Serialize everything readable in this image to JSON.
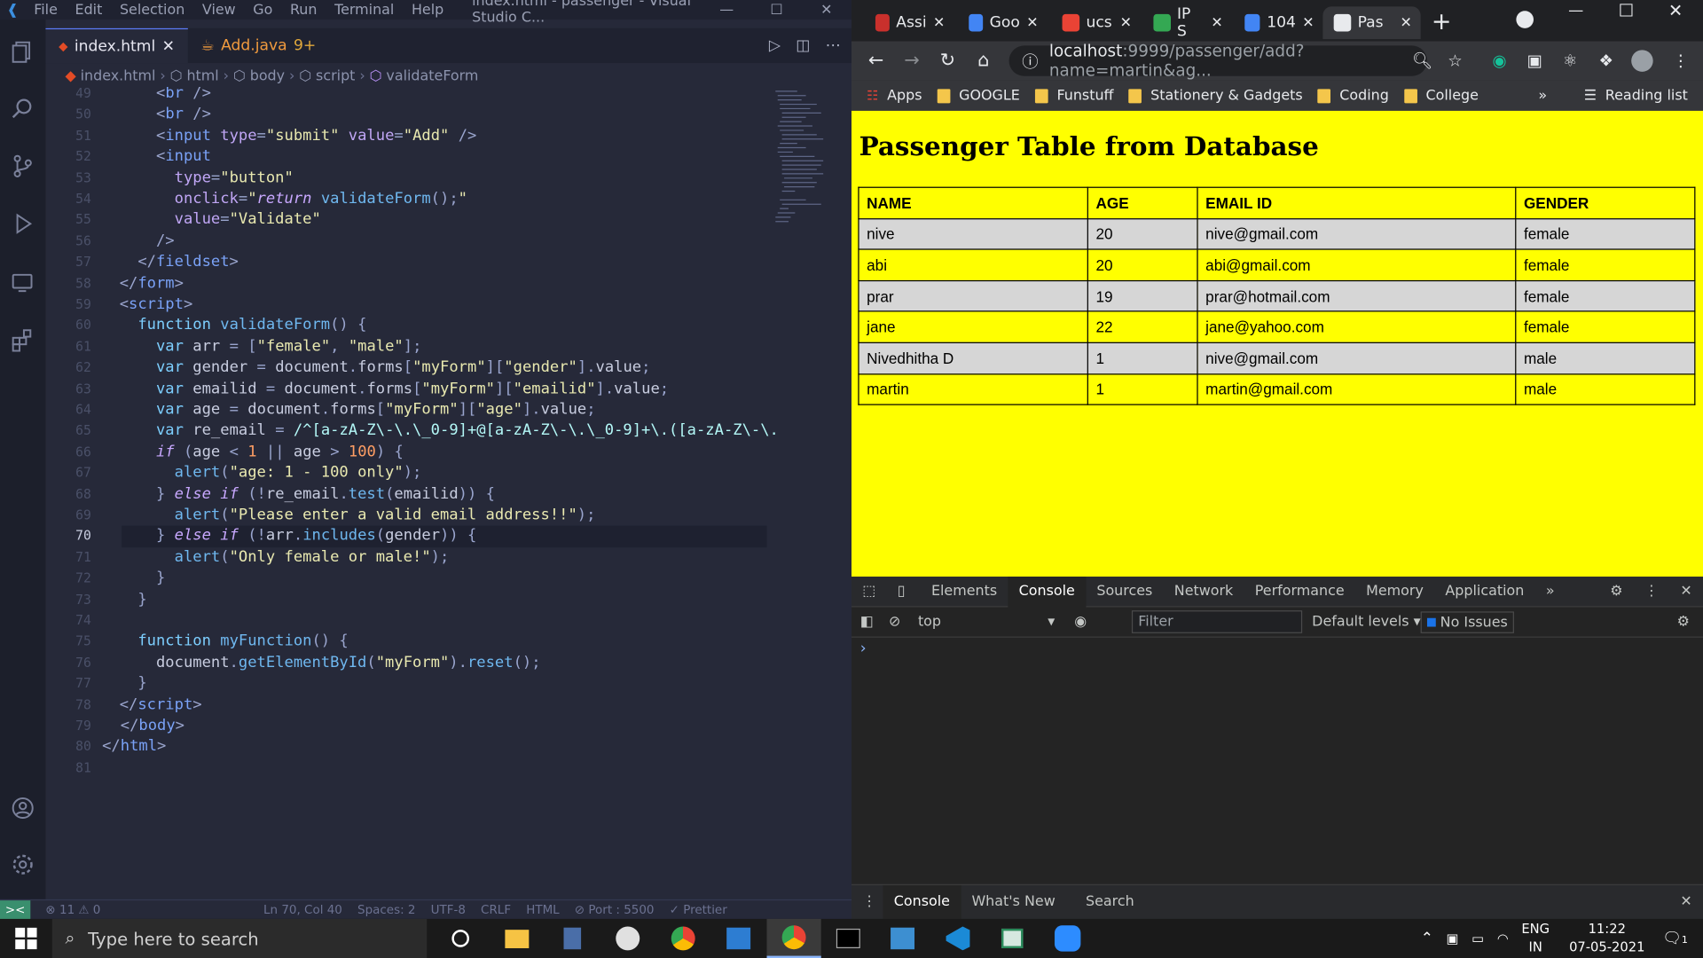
{
  "vscode": {
    "menu": [
      "File",
      "Edit",
      "Selection",
      "View",
      "Go",
      "Run",
      "Terminal",
      "Help"
    ],
    "window_title": "index.html - passenger - Visual Studio C...",
    "tabs": [
      {
        "label": "index.html",
        "close": "✕"
      },
      {
        "label": "Add.java",
        "badge": "9+"
      }
    ],
    "breadcrumb": [
      "index.html",
      "html",
      "body",
      "script",
      "validateForm"
    ],
    "lines": [
      {
        "n": "49",
        "cur": false
      },
      {
        "n": "50"
      },
      {
        "n": "51"
      },
      {
        "n": "52"
      },
      {
        "n": "53"
      },
      {
        "n": "54"
      },
      {
        "n": "55"
      },
      {
        "n": "56"
      },
      {
        "n": "57"
      },
      {
        "n": "58"
      },
      {
        "n": "59"
      },
      {
        "n": "60"
      },
      {
        "n": "61"
      },
      {
        "n": "62"
      },
      {
        "n": "63"
      },
      {
        "n": "64"
      },
      {
        "n": "65"
      },
      {
        "n": "66"
      },
      {
        "n": "67"
      },
      {
        "n": "68"
      },
      {
        "n": "69"
      },
      {
        "n": "70",
        "cur": true
      },
      {
        "n": "71"
      },
      {
        "n": "72"
      },
      {
        "n": "73"
      },
      {
        "n": "74"
      },
      {
        "n": "75"
      },
      {
        "n": "76"
      },
      {
        "n": "77"
      },
      {
        "n": "78"
      },
      {
        "n": "79"
      },
      {
        "n": "80"
      },
      {
        "n": "81"
      }
    ],
    "status": {
      "remote": "><",
      "problems": "⊗ 11 ⚠ 0",
      "position": "Ln 70, Col 40",
      "spaces": "Spaces: 2",
      "encoding": "UTF-8",
      "eol": "CRLF",
      "language": "HTML",
      "port": "⊘ Port : 5500",
      "prettier": "✓ Prettier"
    }
  },
  "chrome": {
    "tabs": [
      {
        "label": "Assi",
        "color": "#0a66c2"
      },
      {
        "label": "Goo",
        "color": "#4285f4"
      },
      {
        "label": "ucs",
        "color": "#ea4335"
      },
      {
        "label": "IP S",
        "color": "#34a853"
      },
      {
        "label": "104",
        "color": "#4285f4"
      },
      {
        "label": "Pas",
        "color": "#e8eaed",
        "active": true
      }
    ],
    "new_tab": "+",
    "url_host": "localhost",
    "url_rest": ":9999/passenger/add?name=martin&ag...",
    "bookmarks": [
      "Apps",
      "GOOGLE",
      "Funstuff",
      "Stationery & Gadgets",
      "Coding",
      "College"
    ],
    "more_bookmarks": "»",
    "reading_list": "Reading list",
    "page": {
      "heading": "Passenger Table from Database",
      "columns": [
        "NAME",
        "AGE",
        "EMAIL ID",
        "GENDER"
      ],
      "rows": [
        [
          "nive",
          "20",
          "nive@gmail.com",
          "female"
        ],
        [
          "abi",
          "20",
          "abi@gmail.com",
          "female"
        ],
        [
          "prar",
          "19",
          "prar@hotmail.com",
          "female"
        ],
        [
          "jane",
          "22",
          "jane@yahoo.com",
          "female"
        ],
        [
          "Nivedhitha D",
          "1",
          "nive@gmail.com",
          "male"
        ],
        [
          "martin",
          "1",
          "martin@gmail.com",
          "male"
        ]
      ]
    },
    "devtools": {
      "tabs": [
        "Elements",
        "Console",
        "Sources",
        "Network",
        "Performance",
        "Memory",
        "Application"
      ],
      "active_tab": "Console",
      "more": "»",
      "context": "top",
      "filter_placeholder": "Filter",
      "levels": "Default levels ▾",
      "issues": "No Issues",
      "prompt": "›",
      "drawer_tabs": [
        "Console",
        "What's New",
        "Search"
      ]
    }
  },
  "taskbar": {
    "search_placeholder": "Type here to search",
    "lang": "ENG",
    "region": "IN",
    "time": "11:22",
    "date": "07-05-2021",
    "notifications": "1"
  }
}
